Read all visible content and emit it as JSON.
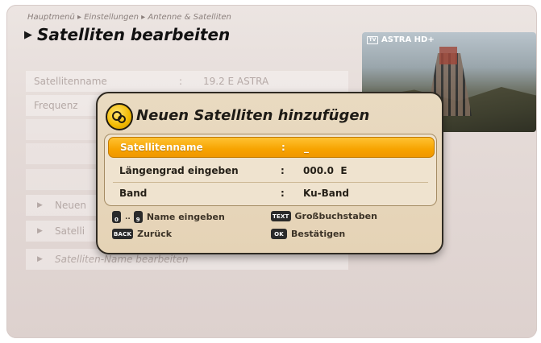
{
  "header": {
    "breadcrumb": "Hauptmenü ▸ Einstellungen ▸ Antenne & Satelliten",
    "title": "Satelliten bearbeiten"
  },
  "background_list": [
    {
      "label": "Satellitenname",
      "colon": ":",
      "value": "19.2 E ASTRA"
    },
    {
      "label": "Frequenz",
      "colon": "",
      "value": ""
    },
    {
      "label": "Neuen",
      "colon": "",
      "value": ""
    },
    {
      "label": "Satelli",
      "colon": "",
      "value": ""
    },
    {
      "label": "Satelliten-Name bearbeiten",
      "colon": "",
      "value": ""
    }
  ],
  "preview": {
    "channel": "ASTRA HD+",
    "tv_icon_label": "TV"
  },
  "dialog": {
    "title": "Neuen Satelliten hinzufügen",
    "fields": [
      {
        "label": "Satellitenname",
        "colon": ":",
        "value": "_",
        "selected": true
      },
      {
        "label": "Längengrad eingeben",
        "colon": ":",
        "value": "000.0  E",
        "selected": false
      },
      {
        "label": "Band",
        "colon": ":",
        "value": "Ku-Band",
        "selected": false
      }
    ],
    "hints": {
      "name_keys_start": "0",
      "name_keys_sep": "..",
      "name_keys_end": "9",
      "name_label": "Name eingeben",
      "text_key": "TEXT",
      "text_label": "Großbuchstaben",
      "back_key": "BACK",
      "back_label": "Zurück",
      "ok_key": "OK",
      "ok_label": "Bestätigen"
    }
  },
  "colors": {
    "selected_row": "#f7a300",
    "dialog_bg": "#e7d6bb",
    "screen_bg": "#e4dad7"
  }
}
